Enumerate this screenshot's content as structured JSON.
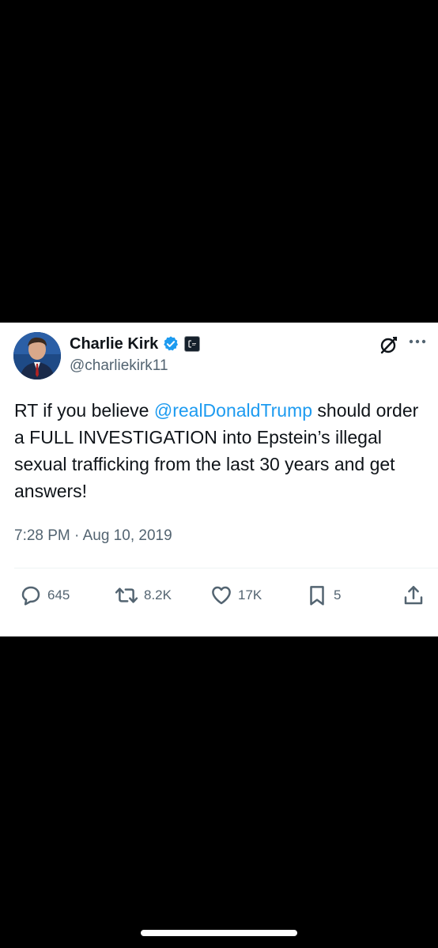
{
  "tweet": {
    "display_name": "Charlie Kirk",
    "handle": "@charliekirk11",
    "text_before": "RT if you believe ",
    "mention": "@realDonaldTrump",
    "text_after": " should order a FULL INVESTIGATION into Epstein’s illegal sexual trafficking from the last 30 years and get answers!",
    "timestamp": "7:28 PM · Aug 10, 2019"
  },
  "actions": {
    "replies": "645",
    "reposts": "8.2K",
    "likes": "17K",
    "bookmarks": "5"
  },
  "icons": {
    "verified": "verified-badge-icon",
    "affiliate": "affiliate-badge-icon",
    "grok": "grok-icon",
    "more": "more-options-icon",
    "reply": "reply-icon",
    "repost": "repost-icon",
    "like": "like-icon",
    "bookmark": "bookmark-icon",
    "share": "share-icon"
  },
  "colors": {
    "accent": "#1d9bf0",
    "text": "#0f1419",
    "secondary": "#536471"
  }
}
